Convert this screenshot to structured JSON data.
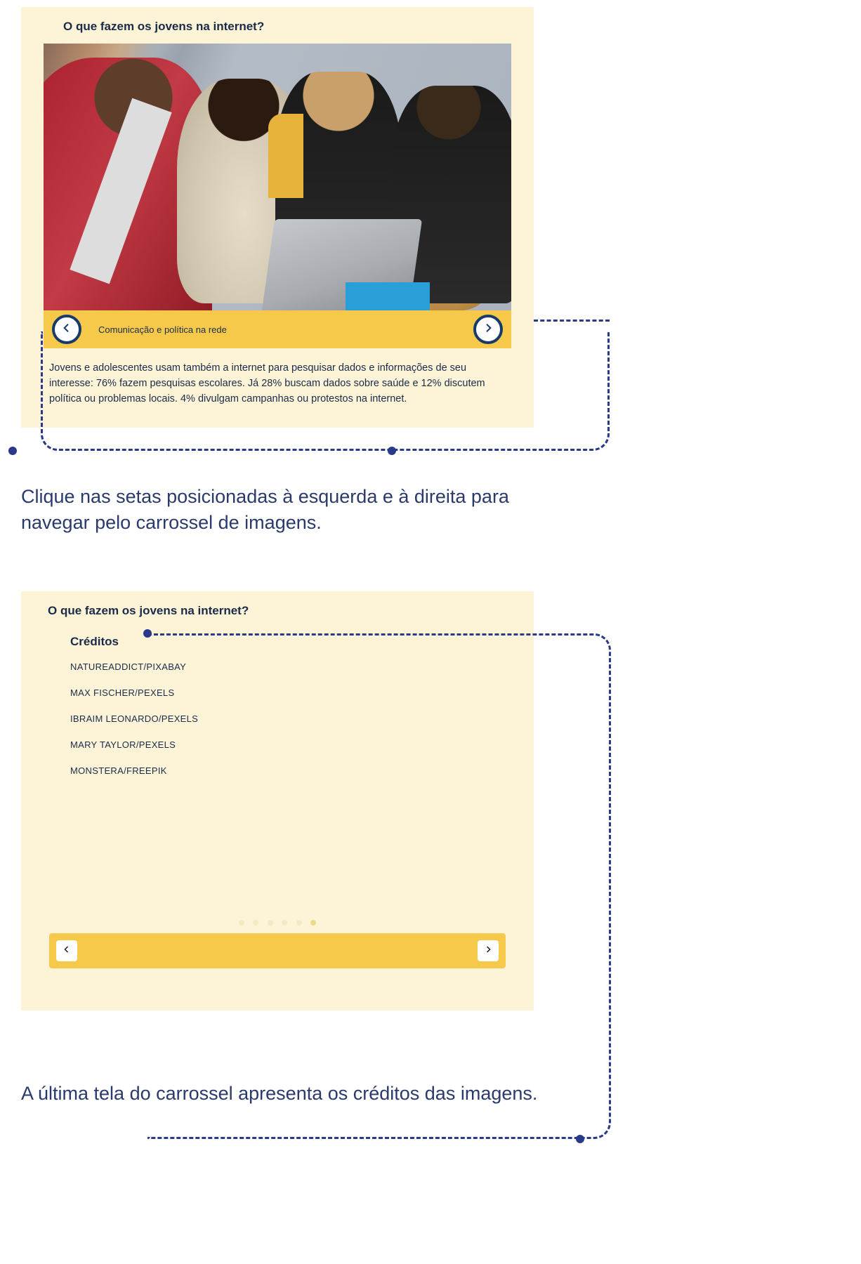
{
  "carousel1": {
    "title": "O que fazem os jovens na internet?",
    "caption": "Comunicação e política na rede",
    "description": "Jovens e adolescentes usam também a internet para pesquisar dados e informações de seu interesse: 76% fazem pesquisas escolares. Já 28% buscam dados sobre saúde e 12% discutem política ou problemas locais. 4% divulgam campanhas ou protestos na internet."
  },
  "callout1": "Clique nas setas posicionadas à esquerda e à direita para navegar pelo carrossel de imagens.",
  "carousel2": {
    "title": "O que fazem os jovens na internet?",
    "credits_label": "Créditos",
    "credits": [
      "NATUREADDICT/PIXABAY",
      "MAX FISCHER/PEXELS",
      "IBRAIM LEONARDO/PEXELS",
      "MARY TAYLOR/PEXELS",
      "MONSTERA/FREEPIK"
    ]
  },
  "callout2": "A última tela do carrossel apresenta os créditos das imagens."
}
